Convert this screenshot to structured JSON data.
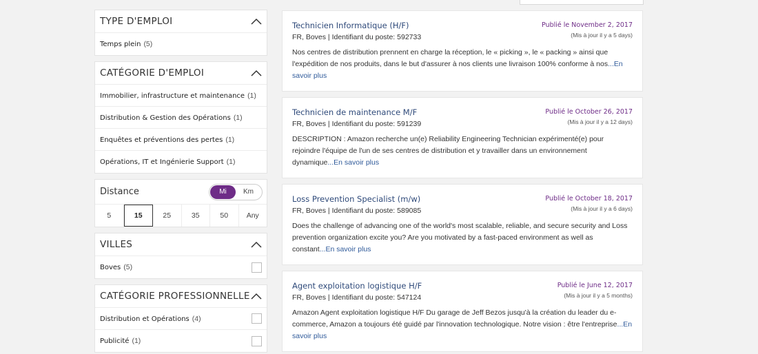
{
  "filters": {
    "type_emploi": {
      "title": "TYPE D'EMPLOI",
      "items": [
        {
          "label": "Temps plein",
          "count": "(5)"
        }
      ]
    },
    "categorie_emploi": {
      "title": "CATÉGORIE D'EMPLOI",
      "items": [
        {
          "label": "Immobilier, infrastructure et maintenance",
          "count": "(1)"
        },
        {
          "label": "Distribution & Gestion des Opérations",
          "count": "(1)"
        },
        {
          "label": "Enquêtes et préventions des pertes",
          "count": "(1)"
        },
        {
          "label": "Opérations, IT et Ingénierie Support",
          "count": "(1)"
        }
      ]
    },
    "distance": {
      "title": "Distance",
      "unit_options": [
        "Mi",
        "Km"
      ],
      "unit_selected": "Mi",
      "options": [
        "5",
        "15",
        "25",
        "35",
        "50",
        "Any"
      ],
      "selected": "15"
    },
    "villes": {
      "title": "VILLES",
      "items": [
        {
          "label": "Boves",
          "count": "(5)"
        }
      ]
    },
    "categorie_pro": {
      "title": "CATÉGORIE PROFESSIONNELLE",
      "items": [
        {
          "label": "Distribution et Opérations",
          "count": "(4)"
        },
        {
          "label": "Publicité",
          "count": "(1)"
        }
      ]
    }
  },
  "jobs": [
    {
      "title": "Technicien Informatique (H/F)",
      "location": "FR, Boves | Identifiant du poste: 592733",
      "published": "Publié le November 2, 2017",
      "updated": "(Mis à jour il y a 5 days)",
      "description": "Nos centres de distribution prennent en charge la réception, le « picking », le « packing » ainsi que l'expédition de nos produits, dans le but d'assurer à nos clients une livraison 100% conforme à nos",
      "more": "...En savoir plus"
    },
    {
      "title": "Technicien de maintenance M/F",
      "location": "FR, Boves | Identifiant du poste: 591239",
      "published": "Publié le October 26, 2017",
      "updated": "(Mis à jour il y a 12 days)",
      "description": "DESCRIPTION : Amazon recherche un(e) Reliability Engineering Technician expérimenté(e) pour rejoindre l'équipe de l'un de ses centres de distribution et y travailler dans un environnement dynamique",
      "more": "...En savoir plus"
    },
    {
      "title": "Loss Prevention Specialist (m/w)",
      "location": "FR, Boves | Identifiant du poste: 589085",
      "published": "Publié le October 18, 2017",
      "updated": "(Mis à jour il y a 6 days)",
      "description": "Does the challenge of advancing one of the world's most scalable, reliable, and secure security and Loss prevention organization excite you? Are you motivated by a fast-paced environment as well as constant",
      "more": "...En savoir plus"
    },
    {
      "title": "Agent exploitation logistique H/F",
      "location": "FR, Boves | Identifiant du poste: 547124",
      "published": "Publié le June 12, 2017",
      "updated": "(Mis à jour il y a 5 months)",
      "description": "Amazon Agent exploitation logistique H/F Du garage de Jeff Bezos jusqu'à la création du leader du e-commerce, Amazon a toujours été guidé par l'innovation technologique. Notre vision : être l'entreprise",
      "more": "...En savoir plus"
    }
  ],
  "colors": {
    "accent": "#6e2c87",
    "link": "#2f4a7a"
  }
}
